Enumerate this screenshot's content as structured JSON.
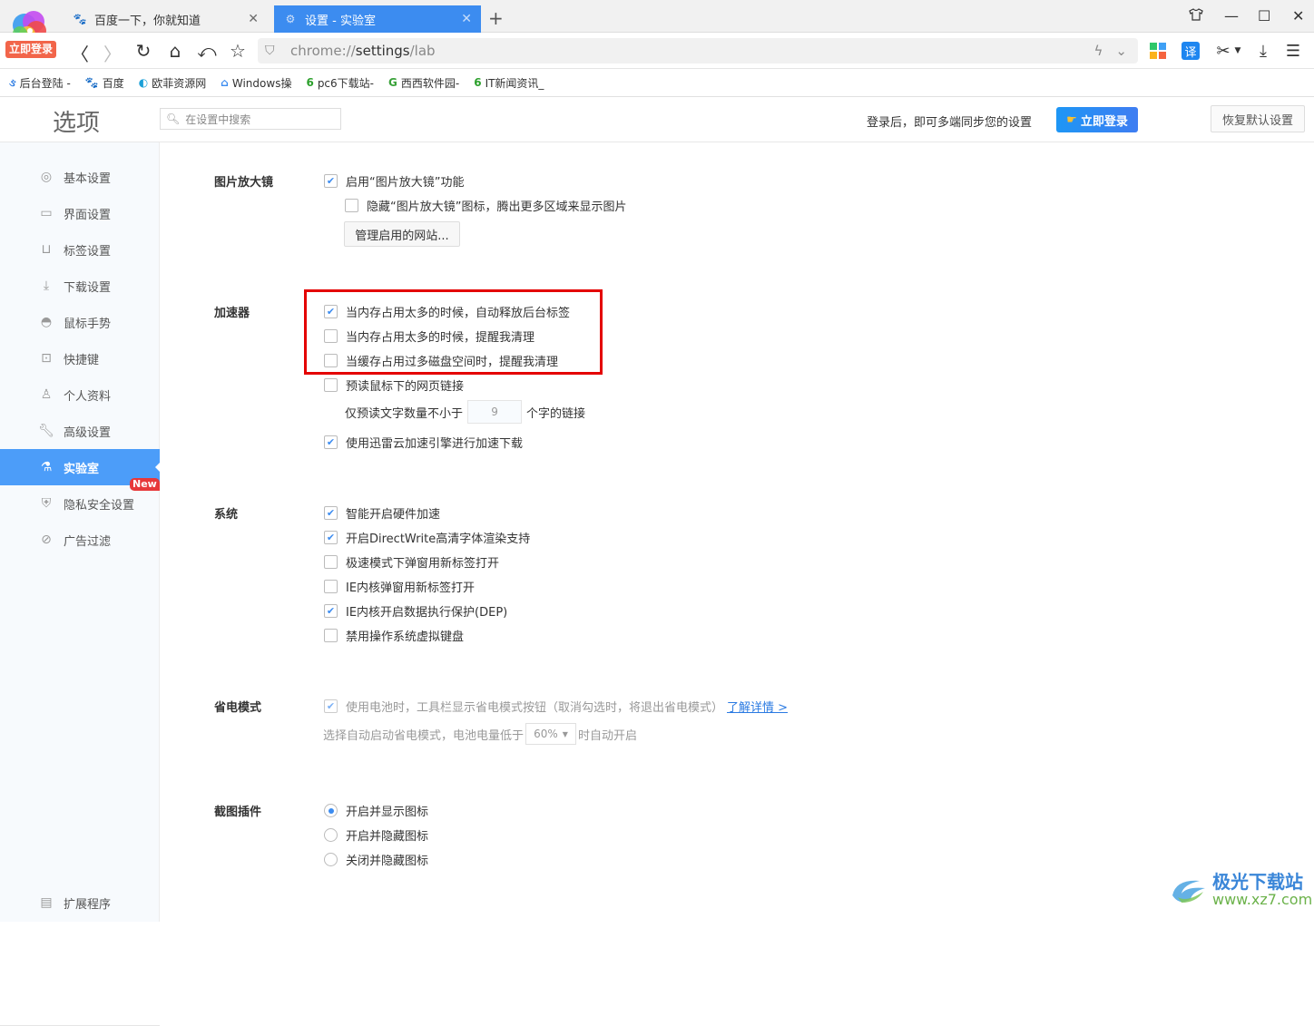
{
  "browser": {
    "login_badge": "立即登录",
    "tabs": [
      {
        "title": "百度一下，你就知道",
        "active": false,
        "icon": "baidu-paw-icon"
      },
      {
        "title": "设置 - 实验室",
        "active": true,
        "icon": "gear-icon"
      }
    ],
    "new_tab": "+",
    "window_controls": {
      "skin": "shirt-icon",
      "minimize": "—",
      "maximize": "☐",
      "close": "✕"
    },
    "address": {
      "scheme": "chrome://",
      "host": "settings",
      "path": "/lab"
    },
    "toolbar_icons": [
      "apps-grid-icon",
      "translate-icon",
      "scissors-icon",
      "download-icon",
      "menu-icon"
    ],
    "translate_label": "译",
    "bookmarks": [
      {
        "label": "后台登陆 -",
        "icon": "swirl-icon",
        "color": "#2a7ae2"
      },
      {
        "label": "百度",
        "icon": "baidu-paw-icon",
        "color": "#2932e1"
      },
      {
        "label": "欧菲资源网",
        "icon": "ofei-icon",
        "color": "#1aa0d8"
      },
      {
        "label": "Windows操",
        "icon": "windows-hat-icon",
        "color": "#3c8cf0"
      },
      {
        "label": "pc6下载站-",
        "icon": "pc6-icon",
        "color": "#2ca02c"
      },
      {
        "label": "西西软件园-",
        "icon": "cc-icon",
        "color": "#3aa23a"
      },
      {
        "label": "IT新闻资讯_",
        "icon": "pc6-icon",
        "color": "#2ca02c"
      }
    ]
  },
  "header": {
    "title": "选项",
    "search_placeholder": "在设置中搜索",
    "sync_text": "登录后，即可多端同步您的设置",
    "login_button": "立即登录",
    "restore_button": "恢复默认设置"
  },
  "sidebar": {
    "items": [
      {
        "label": "基本设置",
        "icon": "settings-icon",
        "active": false
      },
      {
        "label": "界面设置",
        "icon": "window-icon",
        "active": false
      },
      {
        "label": "标签设置",
        "icon": "tab-icon",
        "active": false
      },
      {
        "label": "下载设置",
        "icon": "download-icon",
        "active": false
      },
      {
        "label": "鼠标手势",
        "icon": "mouse-icon",
        "active": false
      },
      {
        "label": "快捷键",
        "icon": "keyboard-icon",
        "active": false
      },
      {
        "label": "个人资料",
        "icon": "user-icon",
        "active": false
      },
      {
        "label": "高级设置",
        "icon": "wrench-icon",
        "active": false
      },
      {
        "label": "实验室",
        "icon": "flask-icon",
        "active": true
      },
      {
        "label": "隐私安全设置",
        "icon": "shield-icon",
        "active": false
      },
      {
        "label": "广告过滤",
        "icon": "block-icon",
        "active": false
      }
    ],
    "new_badge": "New",
    "footer_item": {
      "label": "扩展程序",
      "icon": "extension-icon"
    }
  },
  "sections": {
    "magnifier": {
      "label": "图片放大镜",
      "options": [
        {
          "label": "启用“图片放大镜”功能",
          "checked": true
        },
        {
          "label": "隐藏“图片放大镜”图标，腾出更多区域来显示图片",
          "checked": false
        }
      ],
      "manage_button": "管理启用的网站..."
    },
    "accelerator": {
      "label": "加速器",
      "options": [
        {
          "label": "当内存占用太多的时候，自动释放后台标签",
          "checked": true
        },
        {
          "label": "当内存占用太多的时候，提醒我清理",
          "checked": false
        },
        {
          "label": "当缓存占用过多磁盘空间时，提醒我清理",
          "checked": false
        },
        {
          "label": "预读鼠标下的网页链接",
          "checked": false
        }
      ],
      "preread_prefix": "仅预读文字数量不小于",
      "preread_value": "9",
      "preread_suffix": "个字的链接",
      "thunder": {
        "label": "使用迅雷云加速引擎进行加速下载",
        "checked": true
      }
    },
    "system": {
      "label": "系统",
      "options": [
        {
          "label": "智能开启硬件加速",
          "checked": true
        },
        {
          "label": "开启DirectWrite高清字体渲染支持",
          "checked": true
        },
        {
          "label": "极速模式下弹窗用新标签打开",
          "checked": false
        },
        {
          "label": "IE内核弹窗用新标签打开",
          "checked": false
        },
        {
          "label": "IE内核开启数据执行保护(DEP)",
          "checked": true
        },
        {
          "label": "禁用操作系统虚拟键盘",
          "checked": false
        }
      ]
    },
    "power": {
      "label": "省电模式",
      "option": {
        "label": "使用电池时，工具栏显示省电模式按钮（取消勾选时，将退出省电模式）",
        "checked": true,
        "disabled": true
      },
      "learn_more": "了解详情 >",
      "auto_prefix": "选择自动启动省电模式，电池电量低于",
      "auto_value": "60%",
      "auto_suffix": "时自动开启"
    },
    "screenshot": {
      "label": "截图插件",
      "options": [
        {
          "label": "开启并显示图标",
          "selected": true
        },
        {
          "label": "开启并隐藏图标",
          "selected": false
        },
        {
          "label": "关闭并隐藏图标",
          "selected": false
        }
      ]
    }
  },
  "watermark": {
    "cn": "极光下载站",
    "en": "www.xz7.com"
  }
}
